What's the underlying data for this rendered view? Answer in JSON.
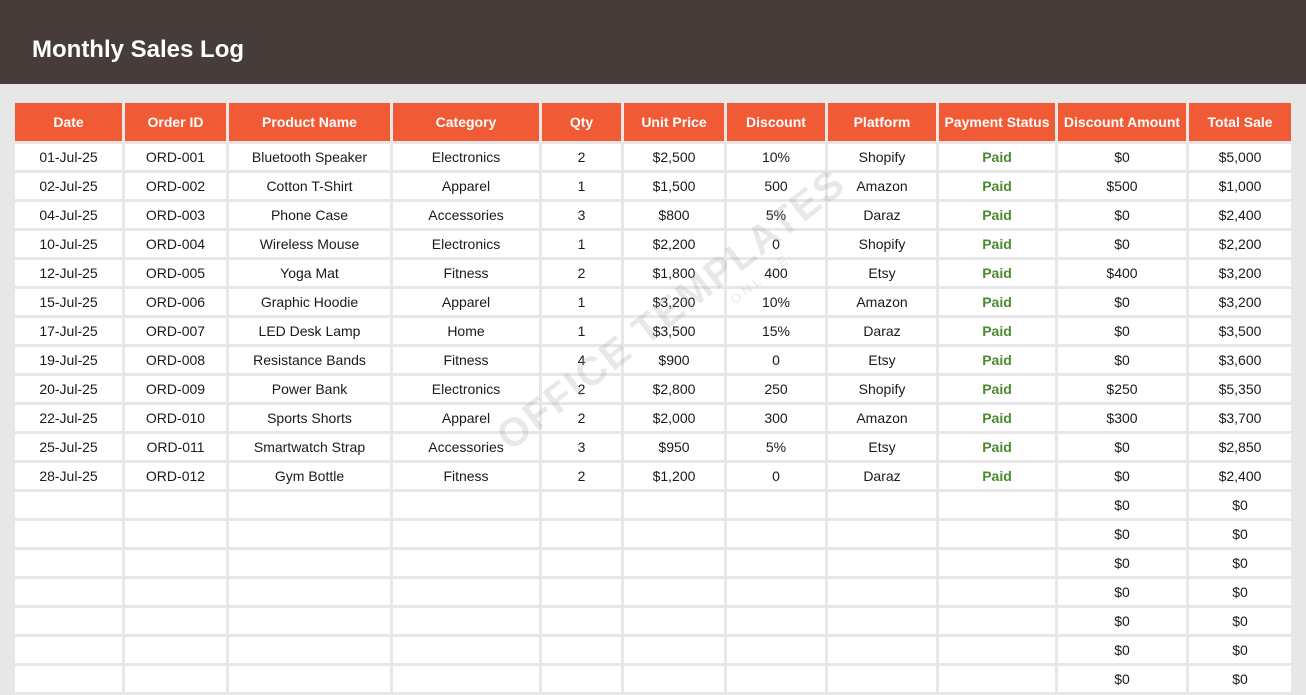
{
  "title": "Monthly Sales Log",
  "watermark": {
    "main": "OFFICE TEMPLATES",
    "sub": "ONLINE"
  },
  "colors": {
    "title_bar": "#463c3a",
    "header": "#f05a35",
    "paid": "#4c8a2f",
    "background": "#e7e7e7"
  },
  "columns": [
    "Date",
    "Order ID",
    "Product Name",
    "Category",
    "Qty",
    "Unit Price",
    "Discount",
    "Platform",
    "Payment Status",
    "Discount Amount",
    "Total Sale"
  ],
  "rows": [
    [
      "01-Jul-25",
      "ORD-001",
      "Bluetooth Speaker",
      "Electronics",
      "2",
      "$2,500",
      "10%",
      "Shopify",
      "Paid",
      "$0",
      "$5,000"
    ],
    [
      "02-Jul-25",
      "ORD-002",
      "Cotton T-Shirt",
      "Apparel",
      "1",
      "$1,500",
      "500",
      "Amazon",
      "Paid",
      "$500",
      "$1,000"
    ],
    [
      "04-Jul-25",
      "ORD-003",
      "Phone Case",
      "Accessories",
      "3",
      "$800",
      "5%",
      "Daraz",
      "Paid",
      "$0",
      "$2,400"
    ],
    [
      "10-Jul-25",
      "ORD-004",
      "Wireless Mouse",
      "Electronics",
      "1",
      "$2,200",
      "0",
      "Shopify",
      "Paid",
      "$0",
      "$2,200"
    ],
    [
      "12-Jul-25",
      "ORD-005",
      "Yoga Mat",
      "Fitness",
      "2",
      "$1,800",
      "400",
      "Etsy",
      "Paid",
      "$400",
      "$3,200"
    ],
    [
      "15-Jul-25",
      "ORD-006",
      "Graphic Hoodie",
      "Apparel",
      "1",
      "$3,200",
      "10%",
      "Amazon",
      "Paid",
      "$0",
      "$3,200"
    ],
    [
      "17-Jul-25",
      "ORD-007",
      "LED Desk Lamp",
      "Home",
      "1",
      "$3,500",
      "15%",
      "Daraz",
      "Paid",
      "$0",
      "$3,500"
    ],
    [
      "19-Jul-25",
      "ORD-008",
      "Resistance Bands",
      "Fitness",
      "4",
      "$900",
      "0",
      "Etsy",
      "Paid",
      "$0",
      "$3,600"
    ],
    [
      "20-Jul-25",
      "ORD-009",
      "Power Bank",
      "Electronics",
      "2",
      "$2,800",
      "250",
      "Shopify",
      "Paid",
      "$250",
      "$5,350"
    ],
    [
      "22-Jul-25",
      "ORD-010",
      "Sports Shorts",
      "Apparel",
      "2",
      "$2,000",
      "300",
      "Amazon",
      "Paid",
      "$300",
      "$3,700"
    ],
    [
      "25-Jul-25",
      "ORD-011",
      "Smartwatch Strap",
      "Accessories",
      "3",
      "$950",
      "5%",
      "Etsy",
      "Paid",
      "$0",
      "$2,850"
    ],
    [
      "28-Jul-25",
      "ORD-012",
      "Gym Bottle",
      "Fitness",
      "2",
      "$1,200",
      "0",
      "Daraz",
      "Paid",
      "$0",
      "$2,400"
    ],
    [
      "",
      "",
      "",
      "",
      "",
      "",
      "",
      "",
      "",
      "$0",
      "$0"
    ],
    [
      "",
      "",
      "",
      "",
      "",
      "",
      "",
      "",
      "",
      "$0",
      "$0"
    ],
    [
      "",
      "",
      "",
      "",
      "",
      "",
      "",
      "",
      "",
      "$0",
      "$0"
    ],
    [
      "",
      "",
      "",
      "",
      "",
      "",
      "",
      "",
      "",
      "$0",
      "$0"
    ],
    [
      "",
      "",
      "",
      "",
      "",
      "",
      "",
      "",
      "",
      "$0",
      "$0"
    ],
    [
      "",
      "",
      "",
      "",
      "",
      "",
      "",
      "",
      "",
      "$0",
      "$0"
    ],
    [
      "",
      "",
      "",
      "",
      "",
      "",
      "",
      "",
      "",
      "$0",
      "$0"
    ]
  ]
}
